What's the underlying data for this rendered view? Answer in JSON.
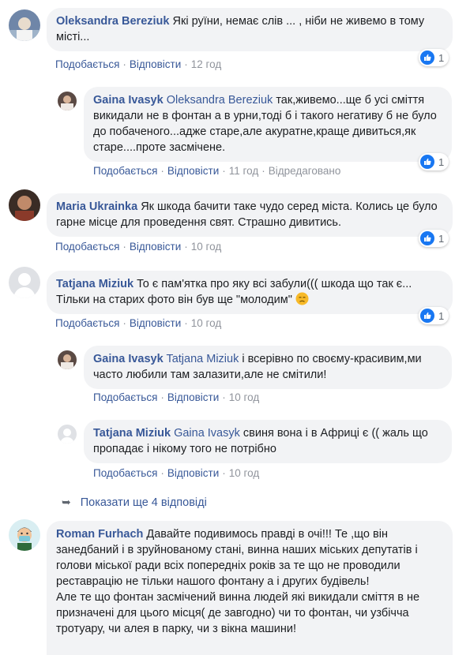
{
  "actions": {
    "like": "Подобається",
    "reply": "Відповісти",
    "edited": "Відредаговано"
  },
  "comments": [
    {
      "author": "Oleksandra Bereziuk",
      "text": "Які руїни, немає слів ... , ніби не живемо в тому місті...",
      "time": "12 год",
      "likes": "1"
    },
    {
      "author": "Gaina Ivasyk",
      "mention": "Oleksandra Bereziuk",
      "text": "так,живемо...ще б усі сміття викидали не в фонтан а в урни,тоді б і такого негативу б не було до побаченого...адже старе,але акуратне,краще дивиться,як старе....проте засмічене.",
      "time": "11 год",
      "likes": "1"
    },
    {
      "author": "Maria Ukrainka",
      "text": "Як шкода бачити таке чудо серед міста. Колись це було гарне місце для проведення свят. Страшно дивитись.",
      "time": "10 год",
      "likes": "1"
    },
    {
      "author": "Tatjana Miziuk",
      "text": "То є пам'ятка про яку всі забули((( шкода що так є... Тільки на старих фото він був ще \"молодим\"",
      "time": "10 год",
      "likes": "1"
    },
    {
      "author": "Gaina Ivasyk",
      "mention": "Tatjana Miziuk",
      "text": "і всерівно по своєму-красивим,ми часто любили там залазити,але не смітили!",
      "time": "10 год"
    },
    {
      "author": "Tatjana Miziuk",
      "mention": "Gaina Ivasyk",
      "text": "свиня вона і в Африці є (( жаль що пропадає і нікому того не потрібно",
      "time": "10 год"
    },
    {
      "author": "Roman Furhach",
      "text": "Давайте подивимось правді в очі!!! Те ,що він занедбаний і в зруйнованому стані, винна наших міських депутатів і голови міської ради всіх попередніх років за те що не проводили реставрацію не тільки нашого фонтану а і других будівель!",
      "text2": "Але те що фонтан засмічений винна людей які викидали сміття в не призначені для цього місця( де завгодно) чи то фонтан, чи узбічча тротуару, чи алея в парку, чи з вікна машини!"
    }
  ],
  "show_more": "Показати ще 4 відповіді"
}
